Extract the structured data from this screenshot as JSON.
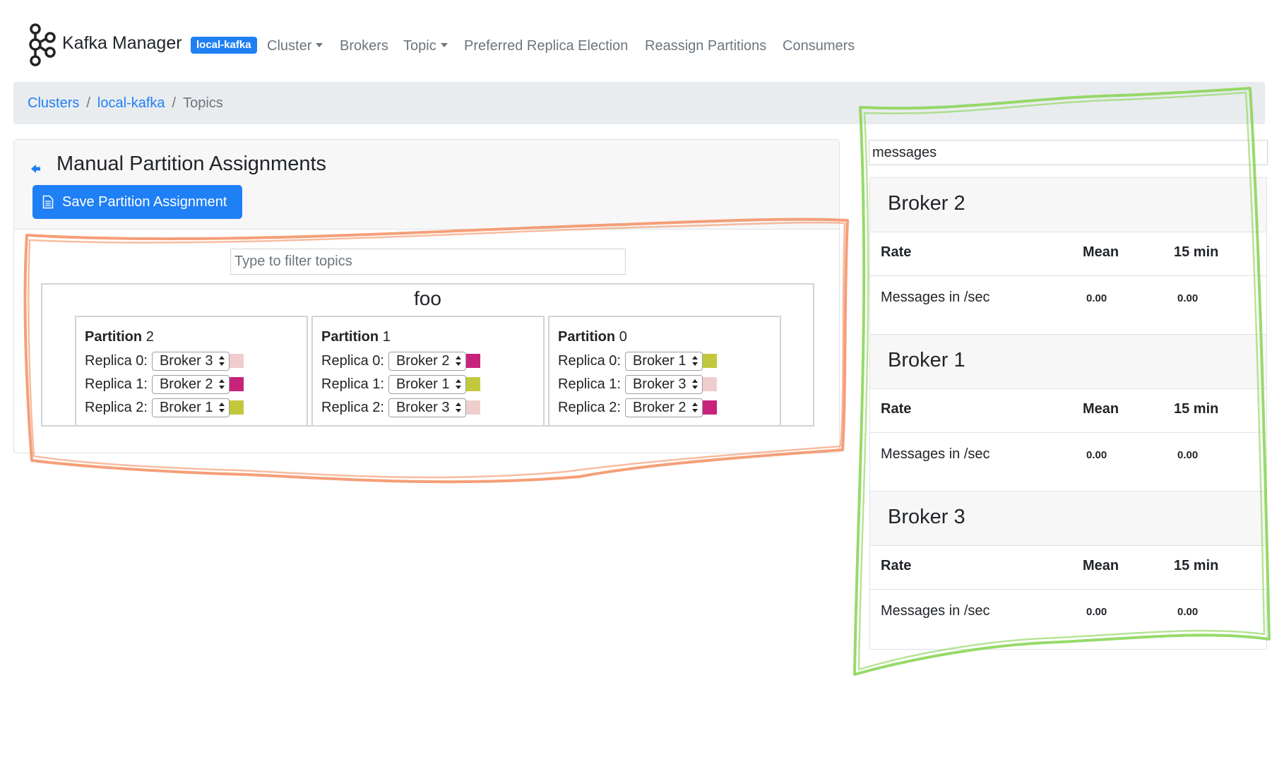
{
  "navbar": {
    "brand": "Kafka Manager",
    "cluster_badge": "local-kafka",
    "items": [
      {
        "label": "Cluster",
        "dropdown": true
      },
      {
        "label": "Brokers",
        "dropdown": false
      },
      {
        "label": "Topic",
        "dropdown": true
      },
      {
        "label": "Preferred Replica Election",
        "dropdown": false
      },
      {
        "label": "Reassign Partitions",
        "dropdown": false
      },
      {
        "label": "Consumers",
        "dropdown": false
      }
    ]
  },
  "breadcrumb": {
    "items": [
      "Clusters",
      "local-kafka"
    ],
    "current": "Topics"
  },
  "assignment": {
    "title": "Manual Partition Assignments",
    "back_icon": "arrow-left-icon",
    "save_button": {
      "label": "Save Partition Assignment",
      "icon": "document-icon"
    },
    "filter_placeholder": "Type to filter topics",
    "topic": {
      "name": "foo",
      "partitions": [
        {
          "label": "Partition",
          "number": "2",
          "replicas": [
            {
              "label": "Replica 0:",
              "broker": "Broker 3",
              "color": "#f0cdcd"
            },
            {
              "label": "Replica 1:",
              "broker": "Broker 2",
              "color": "#c8237b"
            },
            {
              "label": "Replica 2:",
              "broker": "Broker 1",
              "color": "#c2c83c"
            }
          ]
        },
        {
          "label": "Partition",
          "number": "1",
          "replicas": [
            {
              "label": "Replica 0:",
              "broker": "Broker 2",
              "color": "#c8237b"
            },
            {
              "label": "Replica 1:",
              "broker": "Broker 1",
              "color": "#c2c83c"
            },
            {
              "label": "Replica 2:",
              "broker": "Broker 3",
              "color": "#f0cdcd"
            }
          ]
        },
        {
          "label": "Partition",
          "number": "0",
          "replicas": [
            {
              "label": "Replica 0:",
              "broker": "Broker 1",
              "color": "#c2c83c"
            },
            {
              "label": "Replica 1:",
              "broker": "Broker 3",
              "color": "#f0cdcd"
            },
            {
              "label": "Replica 2:",
              "broker": "Broker 2",
              "color": "#c8237b"
            }
          ]
        }
      ]
    }
  },
  "metrics": {
    "search_value": "messages",
    "brokers": [
      {
        "title": "Broker 2",
        "header": {
          "rate": "Rate",
          "mean": "Mean",
          "fifteen": "15 min"
        },
        "row": {
          "name": "Messages in /sec",
          "mean": "0.00",
          "fifteen": "0.00"
        }
      },
      {
        "title": "Broker 1",
        "header": {
          "rate": "Rate",
          "mean": "Mean",
          "fifteen": "15 min"
        },
        "row": {
          "name": "Messages in /sec",
          "mean": "0.00",
          "fifteen": "0.00"
        }
      },
      {
        "title": "Broker 3",
        "header": {
          "rate": "Rate",
          "mean": "Mean",
          "fifteen": "15 min"
        },
        "row": {
          "name": "Messages in /sec",
          "mean": "0.00",
          "fifteen": "0.00"
        }
      }
    ]
  },
  "colors": {
    "accent": "#1f7ff5",
    "highlight_orange": "#f4956a",
    "highlight_green": "#8cd65a"
  }
}
